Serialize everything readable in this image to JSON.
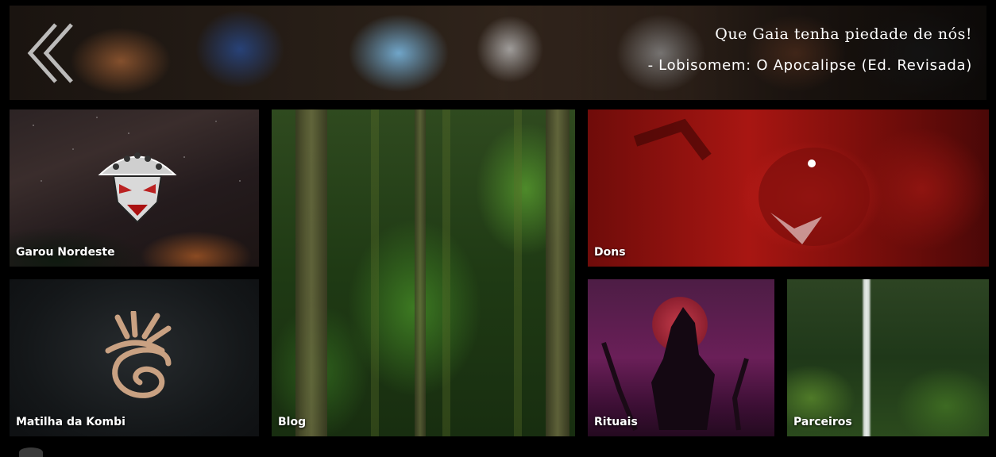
{
  "banner": {
    "quote_line1": "Que Gaia tenha piedade de nós!",
    "quote_line2": "- Lobisomem: O Apocalipse (Ed. Revisada)"
  },
  "tiles": {
    "garou": "Garou Nordeste",
    "matilha": "Matilha da Kombi",
    "blog": "Blog",
    "dons": "Dons",
    "rituais": "Rituais",
    "parceiros": "Parceiros"
  },
  "icons": {
    "back": "double-chevron-left-icon",
    "garou_logo": "wolf-emblem-icon",
    "matilha_logo": "spiral-glyph-icon",
    "rituais_art": "howling-werewolf-icon"
  },
  "colors": {
    "background": "#000000",
    "text": "#ffffff"
  }
}
